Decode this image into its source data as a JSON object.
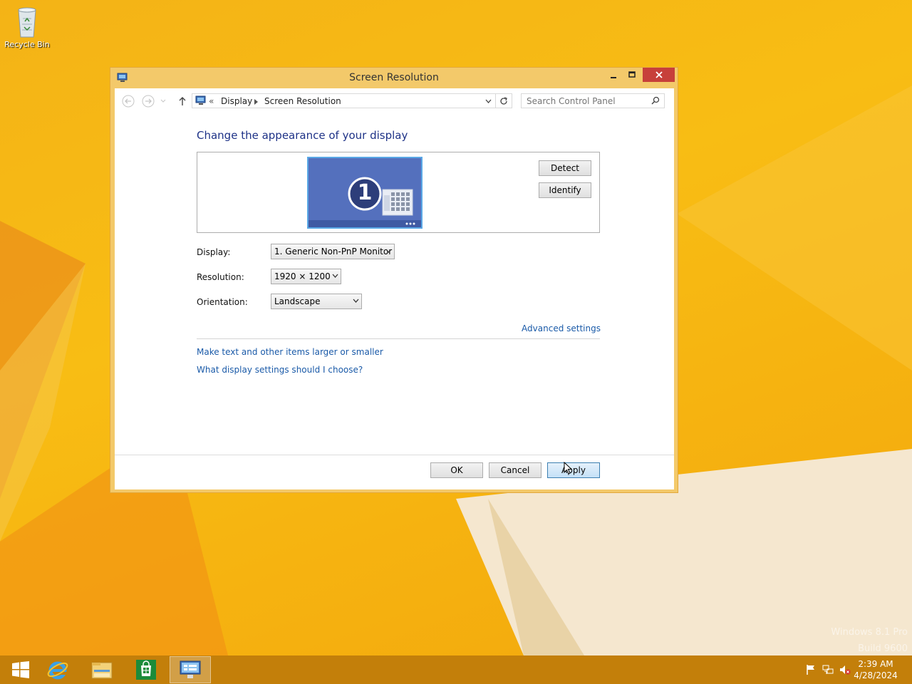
{
  "desktop": {
    "recycle_bin_label": "Recycle Bin",
    "watermark_line1": "Windows 8.1 Pro",
    "watermark_line2": "Build 9600"
  },
  "window": {
    "title": "Screen Resolution",
    "icons": {
      "app": "control-panel-icon",
      "minimize": "minimize-icon",
      "maximize": "maximize-icon",
      "close": "close-icon"
    }
  },
  "address_bar": {
    "prefix": "«",
    "breadcrumb": [
      "Display",
      "Screen Resolution"
    ],
    "search_placeholder": "Search Control Panel"
  },
  "main": {
    "heading": "Change the appearance of your display",
    "monitor_number": "1",
    "detect_label": "Detect",
    "identify_label": "Identify",
    "display_label": "Display:",
    "display_value": "1. Generic Non-PnP Monitor",
    "resolution_label": "Resolution:",
    "resolution_value": "1920 × 1200",
    "orientation_label": "Orientation:",
    "orientation_value": "Landscape",
    "advanced_link": "Advanced settings",
    "link_text_size": "Make text and other items larger or smaller",
    "link_display_settings": "What display settings should I choose?"
  },
  "footer": {
    "ok_label": "OK",
    "cancel_label": "Cancel",
    "apply_label": "Apply"
  },
  "taskbar": {
    "time": "2:39 AM",
    "date": "4/28/2024",
    "items": [
      "start-icon",
      "internet-explorer-icon",
      "file-explorer-icon",
      "store-icon",
      "control-panel-icon"
    ]
  },
  "colors": {
    "accent_link": "#1a5aa8",
    "heading": "#1e3287",
    "window_frame": "#f3c96a",
    "close_button": "#c7403a",
    "taskbar": "#c37f0a"
  }
}
